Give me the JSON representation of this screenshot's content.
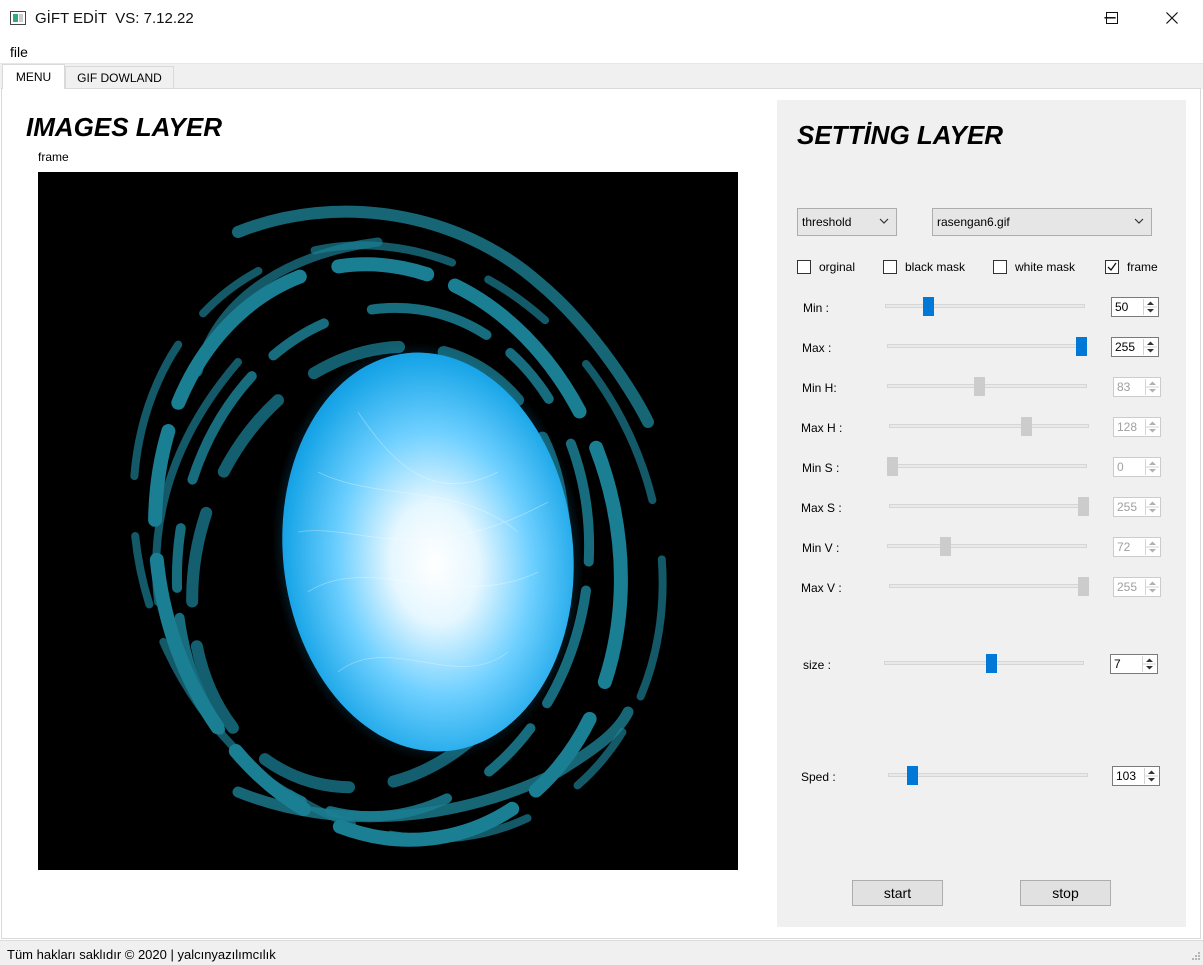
{
  "window": {
    "title": "GİFT EDİT  VS: 7.12.22",
    "minimize_glyph": "─",
    "maximize_glyph": "☐",
    "close_glyph": "✕"
  },
  "menu": {
    "file": "file"
  },
  "tabs": [
    {
      "label": "MENU",
      "selected": true
    },
    {
      "label": "GIF DOWLAND",
      "selected": false
    }
  ],
  "images_layer": {
    "title": "IMAGES LAYER",
    "frame_label": "frame"
  },
  "settings": {
    "title": "SETTİNG LAYER",
    "mode_combo": "threshold",
    "file_combo": "rasengan6.gif",
    "checkboxes": [
      {
        "label": "orginal",
        "checked": false
      },
      {
        "label": "black mask",
        "checked": false
      },
      {
        "label": "white mask",
        "checked": false
      },
      {
        "label": "frame",
        "checked": true
      }
    ],
    "sliders": [
      {
        "label": "Min :",
        "value": "50",
        "enabled": true,
        "position": 0.2
      },
      {
        "label": "Max :",
        "value": "255",
        "enabled": true,
        "position": 1.0
      },
      {
        "label": "Min H:",
        "value": "83",
        "enabled": false,
        "position": 0.46
      },
      {
        "label": "Max H :",
        "value": "128",
        "enabled": false,
        "position": 0.7
      },
      {
        "label": "Min S :",
        "value": "0",
        "enabled": false,
        "position": 0.0
      },
      {
        "label": "Max S :",
        "value": "255",
        "enabled": false,
        "position": 1.0
      },
      {
        "label": "Min V :",
        "value": "72",
        "enabled": false,
        "position": 0.28
      },
      {
        "label": "Max V :",
        "value": "255",
        "enabled": false,
        "position": 1.0
      },
      {
        "label": "size :",
        "value": "7",
        "enabled": true,
        "position": 0.54
      },
      {
        "label": "Sped :",
        "value": "103",
        "enabled": true,
        "position": 0.1
      }
    ],
    "start_button": "start",
    "stop_button": "stop"
  },
  "status": {
    "text": "Tüm hakları saklıdır © 2020 | yalcınyazılımcılık"
  },
  "colors": {
    "accent": "#0078d7",
    "panel": "#f0f0f0",
    "orb": "#1aa6e8",
    "swirl": "#1b7f94"
  }
}
